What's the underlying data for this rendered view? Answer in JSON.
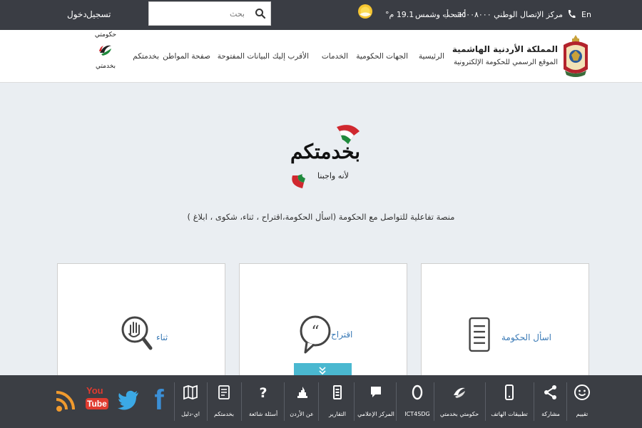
{
  "topbar": {
    "lang": "En",
    "hotline": "مركز الإتصال الوطني ٠٦٥٠٠٨٠٠٠",
    "font_increase": "أ+",
    "font_decrease": "أ-",
    "weather_text": "سحب وشمس",
    "weather_temp": "19.1 م°",
    "search_placeholder": "بحث",
    "register": "تسجيل",
    "login": "دخول"
  },
  "header": {
    "title": "المملكة الأردنية الهاشمية",
    "subtitle": "الموقع الرسمي للحكومة الإلكترونية",
    "nav": [
      "الرئيسية",
      "الجهات الحكومية",
      "الخدمات",
      "الأقرب إليك",
      "البيانات المفتوحة",
      "صفحة المواطن",
      "بخدمتكم"
    ],
    "mini_logo_top": "حكومتي",
    "mini_logo_bottom": "بخدمتي"
  },
  "main": {
    "logo_text": "بخدمتكم",
    "logo_sub": "لأنه واجبنا",
    "tagline": "منصة تفاعلية للتواصل مع الحكومة (اسأل الحكومة،اقتراح ، ثناء، شكوى ، ابلاغ )",
    "cards": [
      {
        "label": "اسأل الحكومة"
      },
      {
        "label": "اقتراح"
      },
      {
        "label": "ثناء"
      }
    ]
  },
  "footer": {
    "items": [
      {
        "label": "تقييم",
        "icon": "smiley-icon"
      },
      {
        "label": "مشاركة",
        "icon": "share-icon"
      },
      {
        "label": "تطبيقات الهاتف",
        "icon": "phone-icon"
      },
      {
        "label": "حكومتي بخدمتي",
        "icon": "government-logo-icon"
      },
      {
        "label": "ICT4SDG",
        "icon": "ring-icon"
      },
      {
        "label": "المركز الإعلامي",
        "icon": "speech-bubble-icon"
      },
      {
        "label": "التقارير",
        "icon": "report-icon"
      },
      {
        "label": "عن الأردن",
        "icon": "landmark-icon"
      },
      {
        "label": "أسئلة شائعة",
        "icon": "question-icon"
      },
      {
        "label": "بخدمتكم",
        "icon": "document-icon"
      },
      {
        "label": "اي-دليل",
        "icon": "map-icon"
      }
    ],
    "social": [
      {
        "name": "facebook",
        "glyph": "f"
      },
      {
        "name": "twitter"
      },
      {
        "name": "youtube",
        "you": "You",
        "tube": "Tube"
      },
      {
        "name": "rss"
      }
    ]
  },
  "colors": {
    "topbar_bg": "#3a3d44",
    "footer_bg": "#3b3e44",
    "link_blue": "#3a7ab6",
    "accent_cyan": "#4ab8d0",
    "flag_red": "#d0282f",
    "flag_green": "#1f8a3c"
  }
}
